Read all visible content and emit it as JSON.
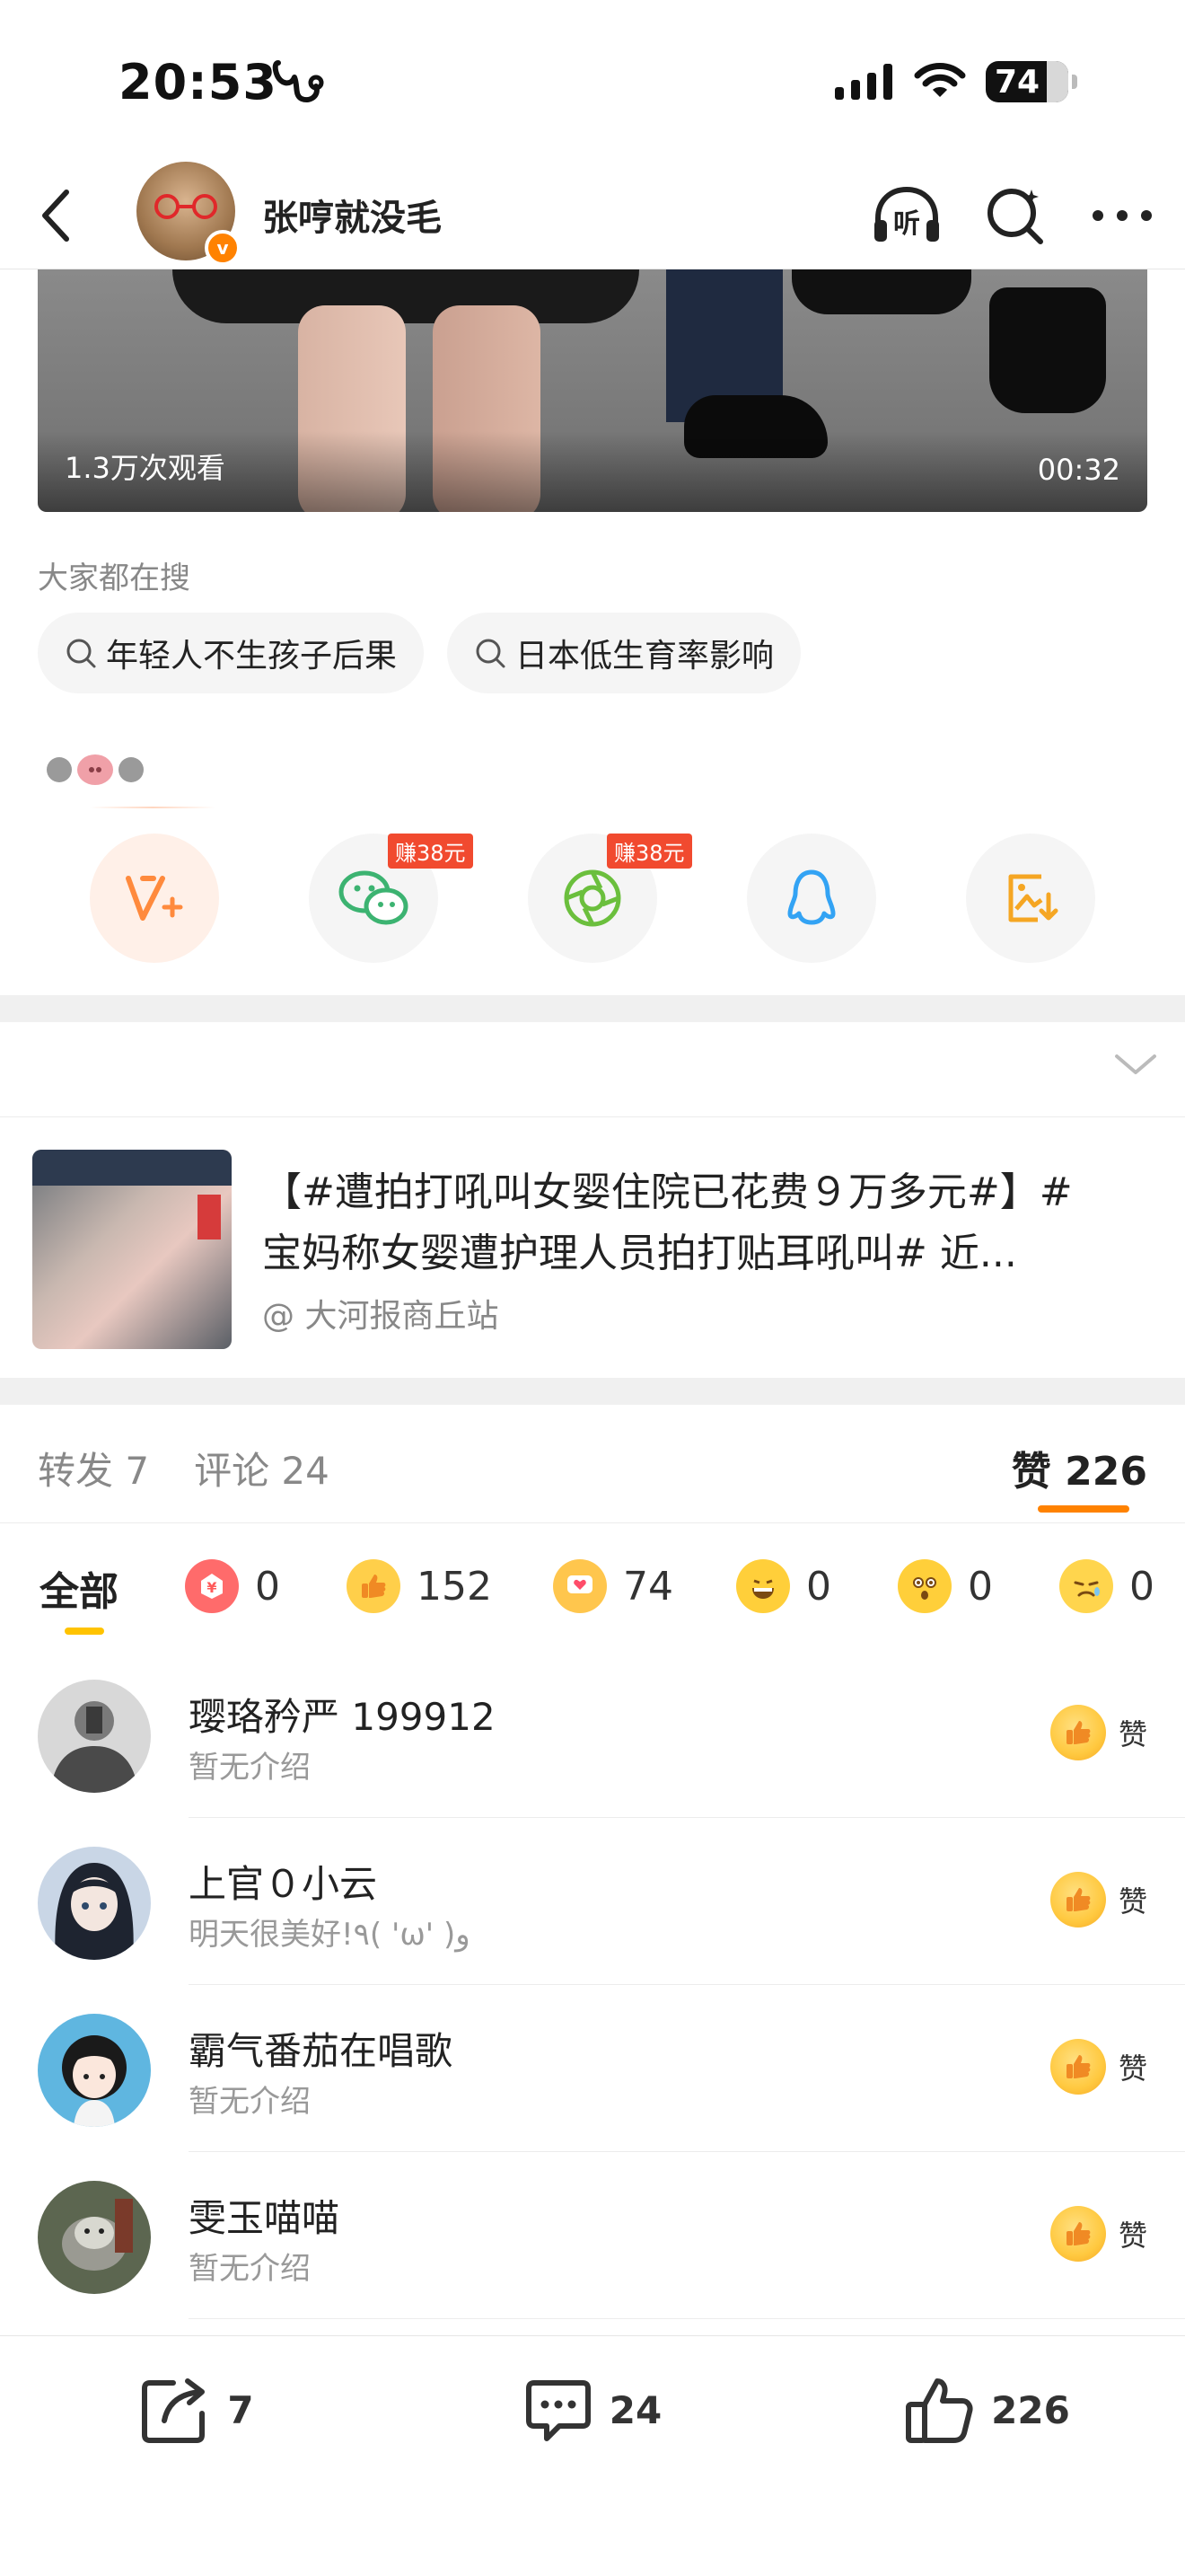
{
  "status_bar": {
    "time": "20:53",
    "battery": "74"
  },
  "header": {
    "username": "张哼就没毛",
    "badge": "v",
    "listen_label": "听"
  },
  "video": {
    "views": "1.3万次观看",
    "duration": "00:32"
  },
  "search": {
    "title": "大家都在搜",
    "chips": [
      "年轻人不生孩子后果",
      "日本低生育率影响"
    ]
  },
  "share": {
    "items": [
      {
        "icon": "v-plus-icon",
        "badge": ""
      },
      {
        "icon": "wechat-icon",
        "badge": "赚38元"
      },
      {
        "icon": "moments-icon",
        "badge": "赚38元"
      },
      {
        "icon": "qq-icon",
        "badge": ""
      },
      {
        "icon": "save-image-icon",
        "badge": ""
      }
    ],
    "accent": "#ff8200"
  },
  "quoted_post": {
    "line1": "【#遭拍打吼叫女婴住院已花费９万多元#】#",
    "line2": "宝妈称女婴遭护理人员拍打贴耳吼叫# 近...",
    "source": "@ 大河报商丘站"
  },
  "stats": {
    "repost": "转发 7",
    "comments": "评论 24",
    "likes": "赞 226"
  },
  "reactions": {
    "all": "全部",
    "items": [
      {
        "icon": "reward-icon",
        "count": "0"
      },
      {
        "icon": "thumbs-up-icon",
        "count": "152"
      },
      {
        "icon": "heart-icon",
        "count": "74"
      },
      {
        "icon": "laugh-icon",
        "count": "0"
      },
      {
        "icon": "surprised-icon",
        "count": "0"
      },
      {
        "icon": "sad-icon",
        "count": "0"
      }
    ]
  },
  "likers": [
    {
      "name": "璎珞矜严 199912",
      "bio": "暂无介绍",
      "label": "赞"
    },
    {
      "name": "上官０小云",
      "bio": "明天很美好!٩( 'ω' )و",
      "label": "赞"
    },
    {
      "name": "霸气番茄在唱歌",
      "bio": "暂无介绍",
      "label": "赞"
    },
    {
      "name": "雯玉喵喵",
      "bio": "暂无介绍",
      "label": "赞"
    }
  ],
  "toolbar": {
    "repost_count": "7",
    "comment_count": "24",
    "like_count": "226"
  }
}
